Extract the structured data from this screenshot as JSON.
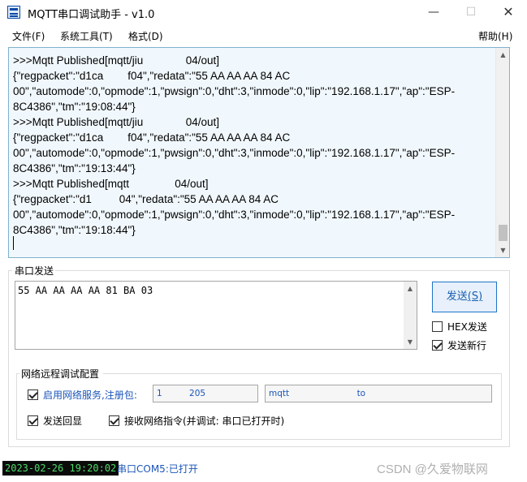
{
  "window": {
    "title": "MQTT串口调试助手 - v1.0",
    "minimize_glyph": "—",
    "maximize_glyph": "☐",
    "close_glyph": "✕"
  },
  "menu": {
    "file": "文件(F)",
    "tools": "系统工具(T)",
    "format": "格式(D)",
    "help": "帮助(H)"
  },
  "receive": {
    "lines": [
      ">>>Mqtt Published[mqtt/jiu              04/out]",
      "{\"regpacket\":\"d1ca        f04\",\"redata\":\"55 AA AA AA 84 AC",
      "00\",\"automode\":0,\"opmode\":1,\"pwsign\":0,\"dht\":3,\"inmode\":0,\"lip\":\"192.168.1.17\",\"ap\":\"ESP-",
      "8C4386\",\"tm\":\"19:08:44\"}",
      ">>>Mqtt Published[mqtt/jiu              04/out]",
      "{\"regpacket\":\"d1ca        f04\",\"redata\":\"55 AA AA AA 84 AC",
      "00\",\"automode\":0,\"opmode\":1,\"pwsign\":0,\"dht\":3,\"inmode\":0,\"lip\":\"192.168.1.17\",\"ap\":\"ESP-",
      "8C4386\",\"tm\":\"19:13:44\"}",
      ">>>Mqtt Published[mqtt               04/out]",
      "{\"regpacket\":\"d1         04\",\"redata\":\"55 AA AA AA 84 AC",
      "00\",\"automode\":0,\"opmode\":1,\"pwsign\":0,\"dht\":3,\"inmode\":0,\"lip\":\"192.168.1.17\",\"ap\":\"ESP-",
      "8C4386\",\"tm\":\"19:18:44\"}"
    ]
  },
  "serial_send": {
    "group_label": "串口发送",
    "input_value": "55 AA AA AA AA 81 BA 03",
    "send_button": "发送",
    "send_button_key": "(S)",
    "hex_send": {
      "label": "HEX发送",
      "checked": false
    },
    "send_newline": {
      "label": "发送新行",
      "checked": true
    }
  },
  "network": {
    "group_label": "网络远程调试配置",
    "enable_service": {
      "label": "启用网络服务,注册包:",
      "checked": true
    },
    "register_packet": "1          205",
    "topic": "mqtt                         to",
    "send_echo": {
      "label": "发送回显",
      "checked": true
    },
    "receive_commands": {
      "label": "接收网络指令(并调试: 串口已打开时)",
      "checked": true
    }
  },
  "status": {
    "datetime": "2023-02-26 19:20:02",
    "port_state": "串口COM5:已打开"
  },
  "watermark": "CSDN @久爱物联网"
}
